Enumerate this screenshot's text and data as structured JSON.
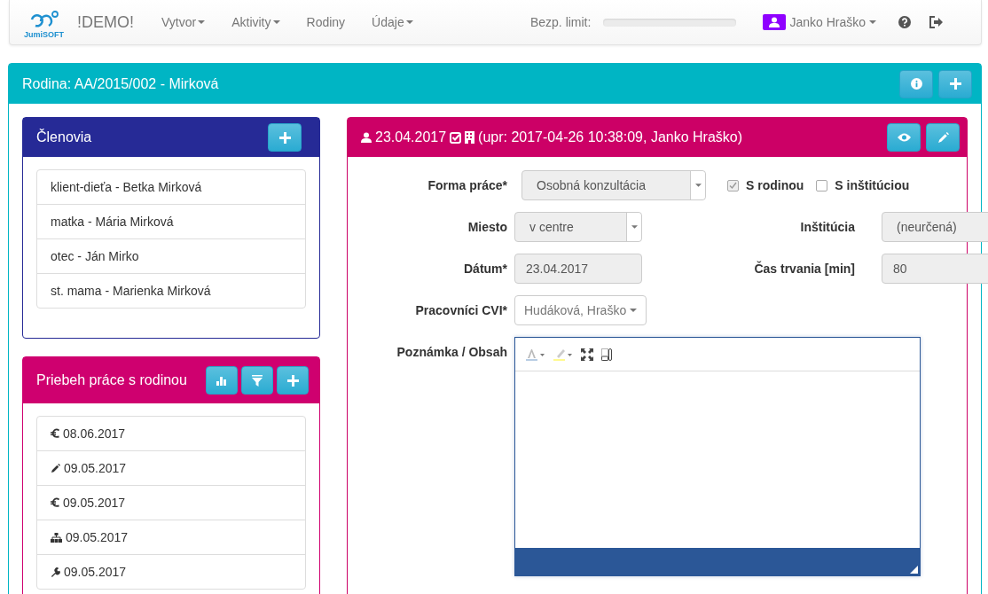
{
  "navbar": {
    "logo_text": "JumiSOFT",
    "brand": "!DEMO!",
    "menu": [
      {
        "label": "Vytvor",
        "dropdown": true
      },
      {
        "label": "Aktivity",
        "dropdown": true
      },
      {
        "label": "Rodiny",
        "dropdown": false
      },
      {
        "label": "Údaje",
        "dropdown": true
      }
    ],
    "limit": {
      "label": "Bezp. limit:",
      "level": 0
    },
    "user": {
      "name": "Janko Hraško"
    }
  },
  "family_panel": {
    "title": "Rodina: AA/2015/002 - Mirková"
  },
  "members": {
    "title": "Členovia",
    "items": [
      "klient-dieťa - Betka Mirková",
      "matka - Mária Mirková",
      "otec - Ján Mirko",
      "st. mama - Marienka Mirková"
    ]
  },
  "progress": {
    "title": "Priebeh práce s rodinou",
    "items": [
      {
        "kind": "euro",
        "date": "08.06.2017"
      },
      {
        "kind": "pencil",
        "date": "09.05.2017"
      },
      {
        "kind": "euro",
        "date": "09.05.2017"
      },
      {
        "kind": "sitemap",
        "date": "09.05.2017"
      },
      {
        "kind": "wrench",
        "date": "09.05.2017"
      }
    ]
  },
  "activity": {
    "date": "23.04.2017",
    "updated": "(upr: 2017-04-26 10:38:09, Janko Hraško)",
    "form_type": {
      "label": "Forma práce*",
      "value": "Osobná konzultácia"
    },
    "checks": [
      {
        "label": "S rodinou",
        "checked": true
      },
      {
        "label": "S inštitúciou",
        "checked": false
      }
    ],
    "place": {
      "label": "Miesto",
      "value": "v centre"
    },
    "institution": {
      "label": "Inštitúcia",
      "value": "(neurčená)"
    },
    "date_field": {
      "label": "Dátum*",
      "value": "23.04.2017"
    },
    "duration": {
      "label": "Čas trvania [min]",
      "value": "80"
    },
    "workers": {
      "label": "Pracovníci CVI*",
      "value": "Hudáková, Hraško"
    },
    "note": {
      "label": "Poznámka / Obsah"
    }
  }
}
